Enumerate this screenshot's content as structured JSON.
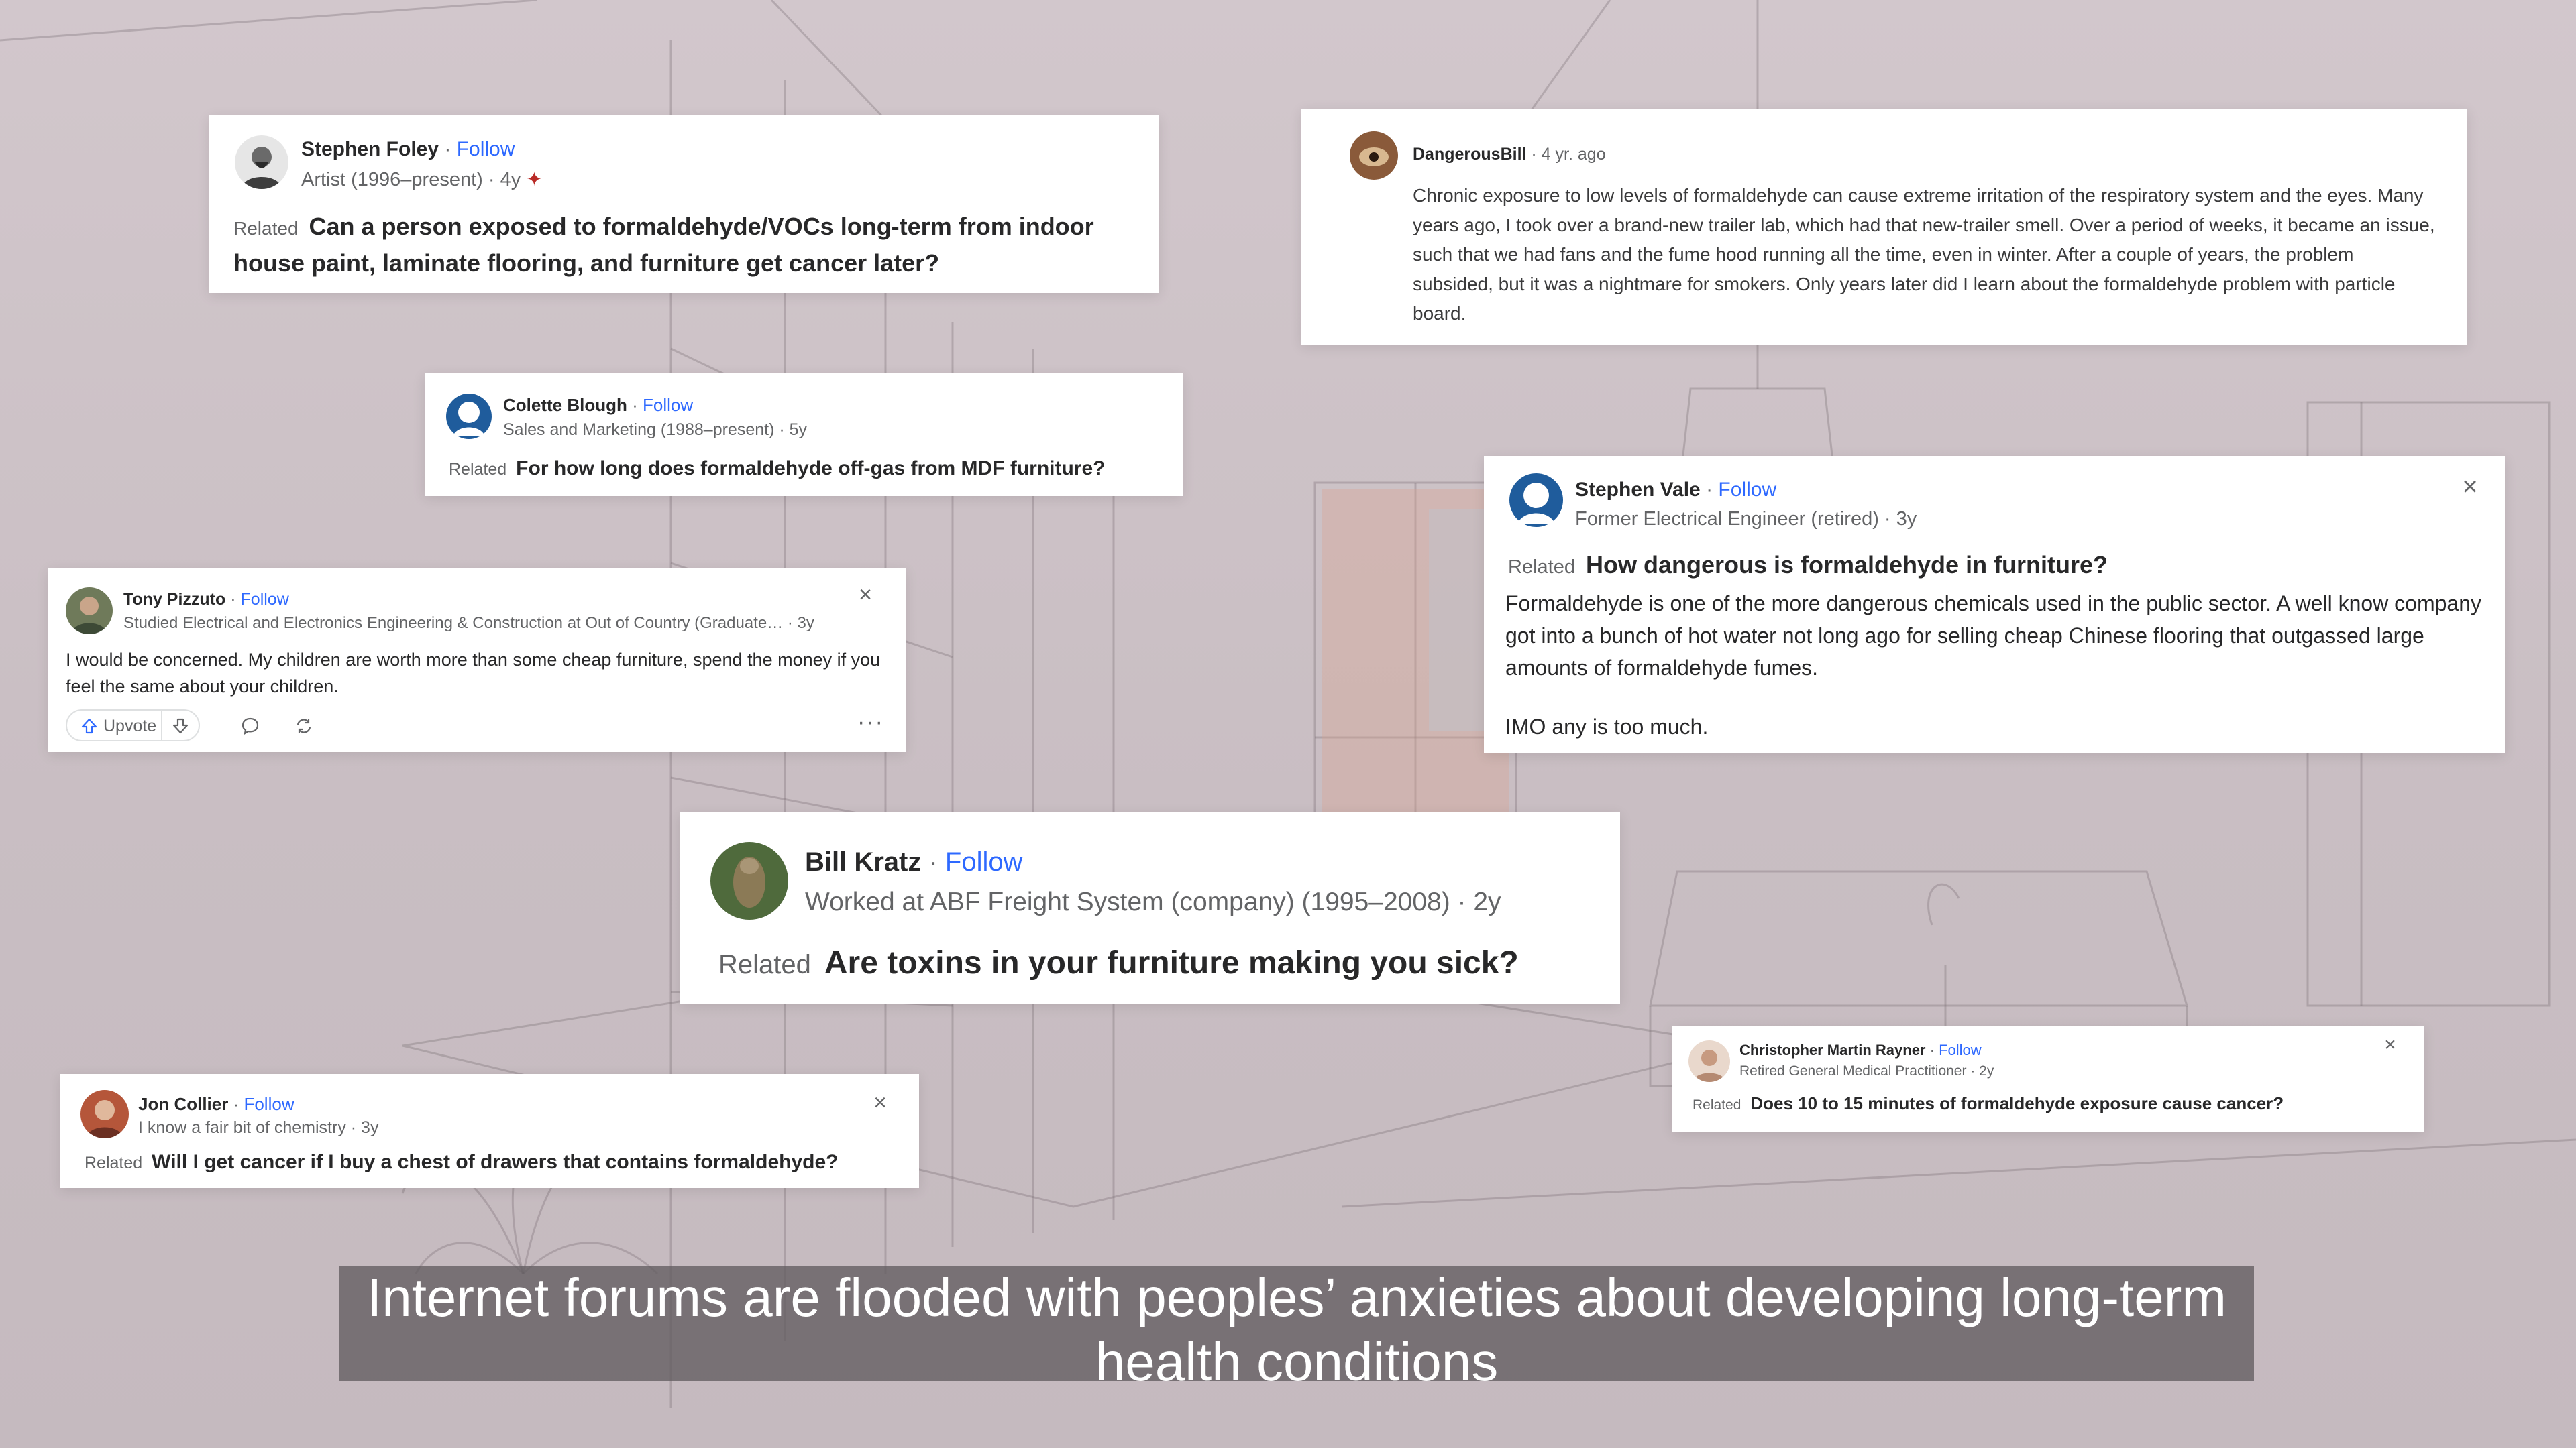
{
  "cards": {
    "foley": {
      "name": "Stephen Foley",
      "dot": " · ",
      "follow": "Follow",
      "credential": "Artist (1996–present) · 4y",
      "spark": "✦",
      "related": "Related",
      "question": "Can a person exposed to formaldehyde/VOCs long-term from indoor house paint, laminate flooring, and furniture get cancer later?"
    },
    "dangerousbill": {
      "name": "DangerousBill",
      "meta": " · 4 yr. ago",
      "body": "Chronic exposure to low levels of formaldehyde can cause extreme irritation of the respiratory system and the eyes. Many years ago, I took over a brand-new trailer lab, which had that new-trailer smell. Over a period of weeks, it became an issue, such that we had fans and the fume hood running all the time, even in winter. After a couple of years, the problem subsided, but it was a nightmare for smokers. Only years later did I learn about the formaldehyde problem with particle board."
    },
    "blough": {
      "name": "Colette Blough",
      "dot": " · ",
      "follow": "Follow",
      "credential": "Sales and Marketing (1988–present) · 5y",
      "related": "Related",
      "question": "For how long does formaldehyde off-gas from MDF furniture?"
    },
    "pizzuto": {
      "name": "Tony Pizzuto",
      "dot": " · ",
      "follow": "Follow",
      "credential": "Studied Electrical and Electronics Engineering & Construction at Out of Country (Graduate… · 3y",
      "body": "I would be concerned. My children are worth more than some cheap furniture, spend the money if you feel the same about your children.",
      "upvote_label": "Upvote",
      "close": "×",
      "more": "···"
    },
    "vale": {
      "name": "Stephen Vale",
      "dot": " · ",
      "follow": "Follow",
      "credential": "Former Electrical Engineer (retired) · 3y",
      "related": "Related",
      "question": "How dangerous is formaldehyde in furniture?",
      "body": "Formaldehyde is one of the more dangerous chemicals used in the public sector. A well know company got into a bunch of hot water not long ago for selling cheap Chinese flooring that outgassed large amounts of formaldehyde fumes.",
      "body2": "IMO any is too much.",
      "close": "×"
    },
    "kratz": {
      "name": "Bill Kratz",
      "dot": " · ",
      "follow": "Follow",
      "credential": "Worked at ABF Freight System (company) (1995–2008) · 2y",
      "related": "Related",
      "question": "Are toxins in your furniture making you sick?"
    },
    "rayner": {
      "name": "Christopher Martin Rayner",
      "dot": " · ",
      "follow": "Follow",
      "credential": "Retired General Medical Practitioner · 2y",
      "related": "Related",
      "question": "Does 10 to 15 minutes of formaldehyde exposure cause cancer?",
      "close": "×"
    },
    "collier": {
      "name": "Jon Collier",
      "dot": " · ",
      "follow": "Follow",
      "credential": "I know a fair bit of chemistry · 3y",
      "related": "Related",
      "question": "Will I get cancer if I buy a chest of drawers that contains formaldehyde?",
      "close": "×"
    }
  },
  "subtitle": {
    "line1": "Internet forums are flooded with peoples’ anxieties about developing long-term",
    "line2": "health conditions"
  },
  "colors": {
    "background": "#cdc2c7",
    "follow": "#2e69ff",
    "card": "#ffffff",
    "subtitle_bg": "#625c60"
  },
  "icons": [
    "upvote-arrow-icon",
    "downvote-arrow-icon",
    "comment-icon",
    "share-icon",
    "close-icon",
    "more-icon"
  ]
}
